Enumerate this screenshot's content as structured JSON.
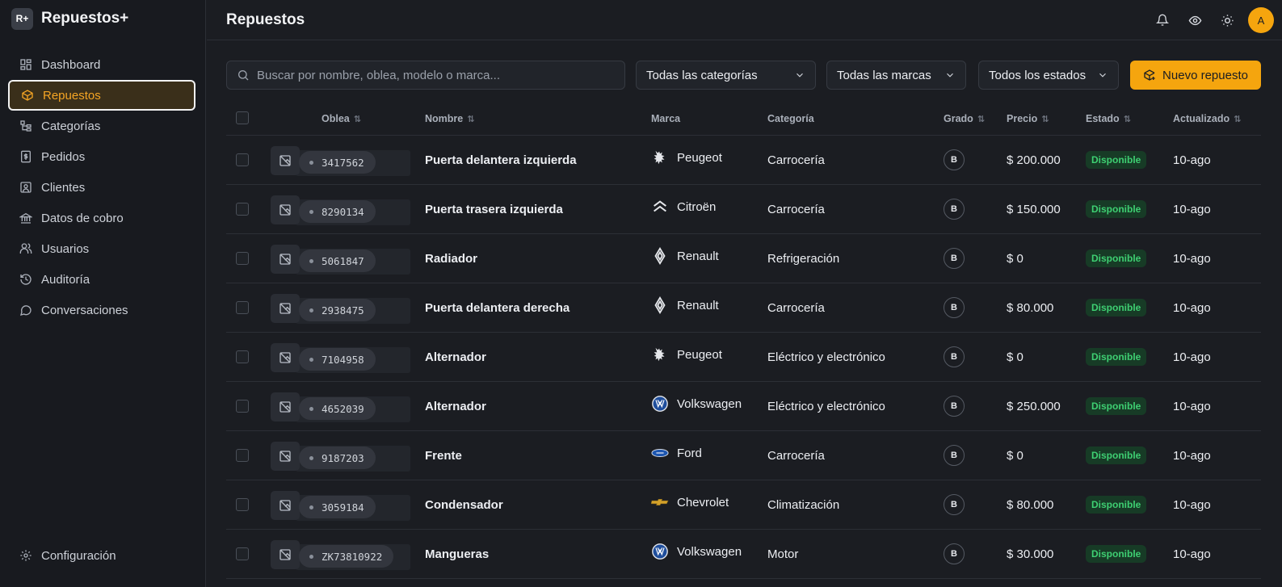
{
  "brand": {
    "logo_text": "R+",
    "name": "Repuestos+"
  },
  "sidebar": {
    "items": [
      {
        "label": "Dashboard",
        "icon": "dashboard-icon",
        "active": false
      },
      {
        "label": "Repuestos",
        "icon": "box-icon",
        "active": true
      },
      {
        "label": "Categorías",
        "icon": "tree-icon",
        "active": false
      },
      {
        "label": "Pedidos",
        "icon": "receipt-icon",
        "active": false
      },
      {
        "label": "Clientes",
        "icon": "contact-icon",
        "active": false
      },
      {
        "label": "Datos de cobro",
        "icon": "bank-icon",
        "active": false
      },
      {
        "label": "Usuarios",
        "icon": "users-icon",
        "active": false
      },
      {
        "label": "Auditoría",
        "icon": "history-icon",
        "active": false
      },
      {
        "label": "Conversaciones",
        "icon": "chat-icon",
        "active": false
      }
    ],
    "settings_label": "Configuración"
  },
  "header": {
    "title": "Repuestos",
    "avatar_initial": "A"
  },
  "toolbar": {
    "search_placeholder": "Buscar por nombre, oblea, modelo o marca...",
    "category_filter": "Todas las categorías",
    "brand_filter": "Todas las marcas",
    "state_filter": "Todos los estados",
    "new_button": "Nuevo repuesto"
  },
  "table": {
    "columns": {
      "oblea": "Oblea",
      "nombre": "Nombre",
      "marca": "Marca",
      "categoria": "Categoría",
      "grado": "Grado",
      "precio": "Precio",
      "estado": "Estado",
      "actualizado": "Actualizado"
    },
    "rows": [
      {
        "oblea": "3417562",
        "nombre": "Puerta delantera izquierda",
        "marca": "Peugeot",
        "brand_icon": "peugeot-lion",
        "categoria": "Carrocería",
        "grado": "B",
        "precio": "$ 200.000",
        "estado": "Disponible",
        "actualizado": "10-ago"
      },
      {
        "oblea": "8290134",
        "nombre": "Puerta trasera izquierda",
        "marca": "Citroën",
        "brand_icon": "citroen-chevrons",
        "categoria": "Carrocería",
        "grado": "B",
        "precio": "$ 150.000",
        "estado": "Disponible",
        "actualizado": "10-ago"
      },
      {
        "oblea": "5061847",
        "nombre": "Radiador",
        "marca": "Renault",
        "brand_icon": "renault-diamond",
        "categoria": "Refrigeración",
        "grado": "B",
        "precio": "$ 0",
        "estado": "Disponible",
        "actualizado": "10-ago"
      },
      {
        "oblea": "2938475",
        "nombre": "Puerta delantera derecha",
        "marca": "Renault",
        "brand_icon": "renault-diamond",
        "categoria": "Carrocería",
        "grado": "B",
        "precio": "$ 80.000",
        "estado": "Disponible",
        "actualizado": "10-ago"
      },
      {
        "oblea": "7104958",
        "nombre": "Alternador",
        "marca": "Peugeot",
        "brand_icon": "peugeot-lion",
        "categoria": "Eléctrico y electrónico",
        "grado": "B",
        "precio": "$ 0",
        "estado": "Disponible",
        "actualizado": "10-ago"
      },
      {
        "oblea": "4652039",
        "nombre": "Alternador",
        "marca": "Volkswagen",
        "brand_icon": "volkswagen-badge",
        "categoria": "Eléctrico y electrónico",
        "grado": "B",
        "precio": "$ 250.000",
        "estado": "Disponible",
        "actualizado": "10-ago"
      },
      {
        "oblea": "9187203",
        "nombre": "Frente",
        "marca": "Ford",
        "brand_icon": "ford-oval",
        "categoria": "Carrocería",
        "grado": "B",
        "precio": "$ 0",
        "estado": "Disponible",
        "actualizado": "10-ago"
      },
      {
        "oblea": "3059184",
        "nombre": "Condensador",
        "marca": "Chevrolet",
        "brand_icon": "chevrolet-bowtie",
        "categoria": "Climatización",
        "grado": "B",
        "precio": "$ 80.000",
        "estado": "Disponible",
        "actualizado": "10-ago"
      },
      {
        "oblea": "ZK73810922",
        "nombre": "Mangueras",
        "marca": "Volkswagen",
        "brand_icon": "volkswagen-badge",
        "categoria": "Motor",
        "grado": "B",
        "precio": "$ 30.000",
        "estado": "Disponible",
        "actualizado": "10-ago"
      }
    ]
  },
  "colors": {
    "accent": "#f5a50e",
    "background": "#1b1d22",
    "success": "#3ecf72"
  }
}
